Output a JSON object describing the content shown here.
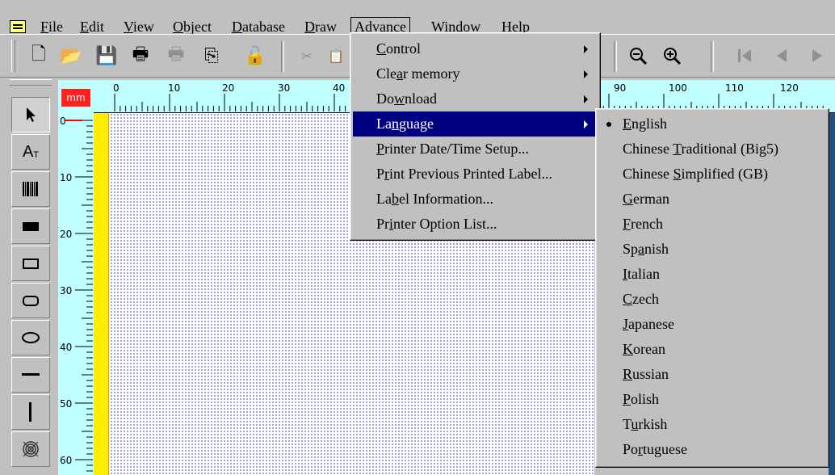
{
  "menubar": {
    "items": [
      {
        "label": "File",
        "u": "F",
        "rest": "ile"
      },
      {
        "label": "Edit",
        "u": "E",
        "rest": "dit"
      },
      {
        "label": "View",
        "u": "V",
        "rest": "iew"
      },
      {
        "label": "Object",
        "u": "O",
        "rest": "bject"
      },
      {
        "label": "Database",
        "u": "D",
        "rest": "atabase"
      },
      {
        "label": "Draw",
        "u": "D",
        "rest": "raw"
      },
      {
        "label": "Advance",
        "u": "A",
        "rest": "dvance"
      },
      {
        "label": "Window",
        "u": "W",
        "rest": "indow"
      },
      {
        "label": "Help",
        "u": "H",
        "rest": "elp"
      }
    ]
  },
  "toolbar": {
    "icons": [
      "new-icon",
      "open-icon",
      "save-icon",
      "print-icon",
      "print-preview-icon",
      "copy-icon",
      "lock-icon",
      "cut-icon",
      "paste-icon",
      "zoom-out-icon",
      "zoom-in-icon",
      "first-page-icon",
      "prev-page-icon",
      "next-page-icon"
    ]
  },
  "palette": {
    "tools": [
      "select-arrow-icon",
      "text-tool-icon",
      "barcode-tool-icon",
      "filled-rectangle-icon",
      "rectangle-icon",
      "rounded-rectangle-icon",
      "ellipse-icon",
      "horizontal-line-icon",
      "vertical-line-icon",
      "qr-code-icon"
    ]
  },
  "rulers": {
    "unit": "mm",
    "h_labels": [
      "0",
      "10",
      "20",
      "30",
      "40",
      "90",
      "100",
      "110",
      "120"
    ],
    "v_labels": [
      "0",
      "10",
      "20",
      "30",
      "40",
      "50",
      "60"
    ]
  },
  "advance_menu": {
    "items": [
      {
        "pre": "",
        "u": "C",
        "post": "ontrol",
        "submenu": true
      },
      {
        "pre": "Cle",
        "u": "a",
        "post": "r memory",
        "submenu": true
      },
      {
        "pre": "Do",
        "u": "w",
        "post": "nload",
        "submenu": true
      },
      {
        "pre": "La",
        "u": "n",
        "post": "guage",
        "submenu": true,
        "selected": true
      },
      {
        "pre": "",
        "u": "P",
        "post": "rinter Date/Time Setup...",
        "submenu": false
      },
      {
        "pre": "P",
        "u": "r",
        "post": "int Previous Printed Label...",
        "submenu": false
      },
      {
        "pre": "La",
        "u": "b",
        "post": "el Information...",
        "submenu": false
      },
      {
        "pre": "Pr",
        "u": "i",
        "post": "nter Option List...",
        "submenu": false
      }
    ]
  },
  "language_menu": {
    "checked": "English",
    "items": [
      {
        "pre": "",
        "u": "E",
        "post": "nglish"
      },
      {
        "pre": "Chinese ",
        "u": "T",
        "post": "raditional (Big5)"
      },
      {
        "pre": "Chinese ",
        "u": "S",
        "post": "implified (GB)"
      },
      {
        "pre": "",
        "u": "G",
        "post": "erman"
      },
      {
        "pre": "",
        "u": "F",
        "post": "rench"
      },
      {
        "pre": "Sp",
        "u": "a",
        "post": "nish"
      },
      {
        "pre": "",
        "u": "I",
        "post": "talian"
      },
      {
        "pre": "",
        "u": "C",
        "post": "zech"
      },
      {
        "pre": "",
        "u": "J",
        "post": "apanese"
      },
      {
        "pre": "",
        "u": "K",
        "post": "orean"
      },
      {
        "pre": "",
        "u": "R",
        "post": "ussian"
      },
      {
        "pre": "",
        "u": "P",
        "post": "olish"
      },
      {
        "pre": "T",
        "u": "u",
        "post": "rkish"
      },
      {
        "pre": "Po",
        "u": "r",
        "post": "tuguese"
      }
    ]
  }
}
